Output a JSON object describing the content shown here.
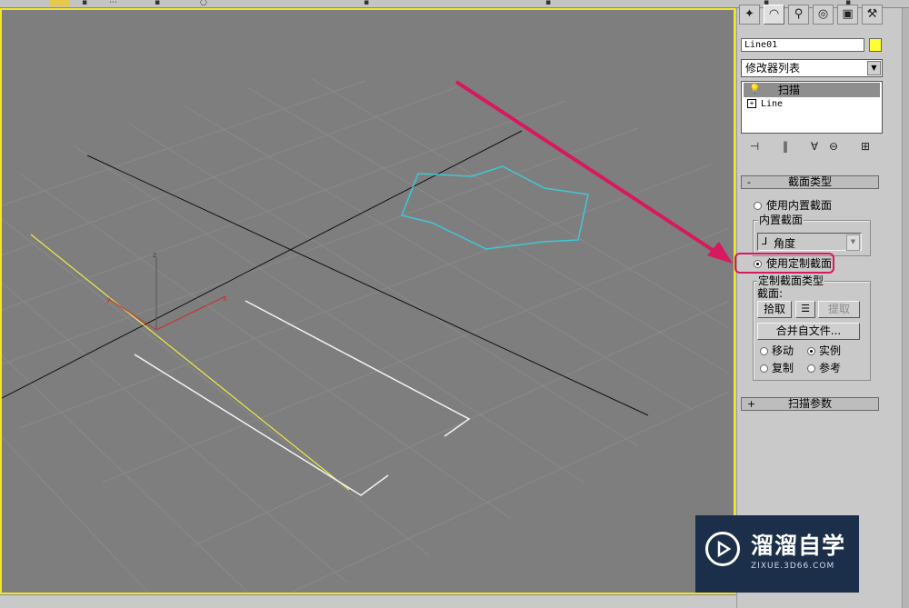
{
  "object": {
    "name": "Line01",
    "color": "#ffff33"
  },
  "modifier_list": {
    "label": "修改器列表"
  },
  "stack": {
    "items": [
      {
        "label": "扫描"
      },
      {
        "label": "Line"
      }
    ]
  },
  "section_type_rollout": {
    "title": "截面类型",
    "use_builtin": "使用内置截面",
    "builtin_group_label": "内置截面",
    "builtin_selected": "角度",
    "use_custom": "使用定制截面",
    "custom_group_label": "定制截面类型",
    "section_label": "截面:",
    "pick_button": "拾取",
    "extract_button": "提取",
    "merge_button": "合并自文件...",
    "move_label": "移动",
    "instance_label": "实例",
    "copy_label": "复制",
    "reference_label": "参考"
  },
  "sweep_params_rollout": {
    "title": "扫描参数"
  },
  "watermark": {
    "title": "溜溜自学",
    "url": "ZIXUE.3D66.COM"
  },
  "colors": {
    "viewport_bg": "#7e7e7e",
    "active_border": "#f2e62a",
    "star_shape": "#3ec8d6",
    "path_line": "#f0e84a",
    "highlight": "#d8185f"
  }
}
